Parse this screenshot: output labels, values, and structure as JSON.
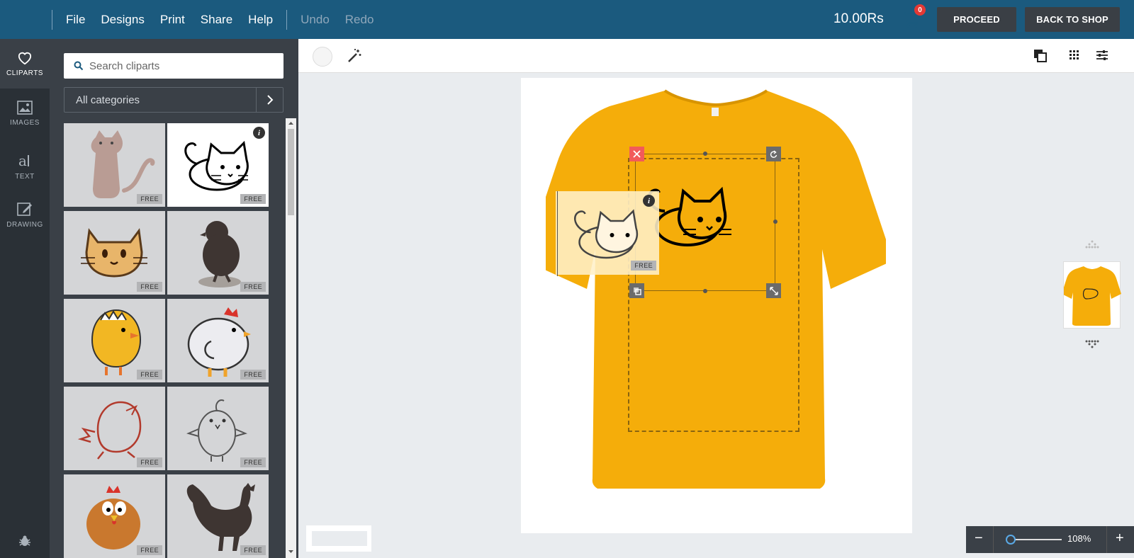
{
  "topbar": {
    "menu": [
      "File",
      "Designs",
      "Print",
      "Share",
      "Help"
    ],
    "undo": "Undo",
    "redo": "Redo",
    "price": "10.00Rs",
    "cart_count": "0",
    "proceed": "PROCEED",
    "back_to_shop": "BACK TO SHOP"
  },
  "leftnav": {
    "cliparts": "CLIPARTS",
    "images": "IMAGES",
    "text": "TEXT",
    "drawing": "DRAWING"
  },
  "panel": {
    "search_placeholder": "Search cliparts",
    "category": "All categories",
    "free_label": "FREE",
    "info_label": "i"
  },
  "zoom": {
    "value": "108%",
    "minus": "−",
    "plus": "+"
  },
  "colors": {
    "shirt": "#f5ad0a",
    "topbar": "#1b5a7e",
    "accent": "#e53935"
  }
}
